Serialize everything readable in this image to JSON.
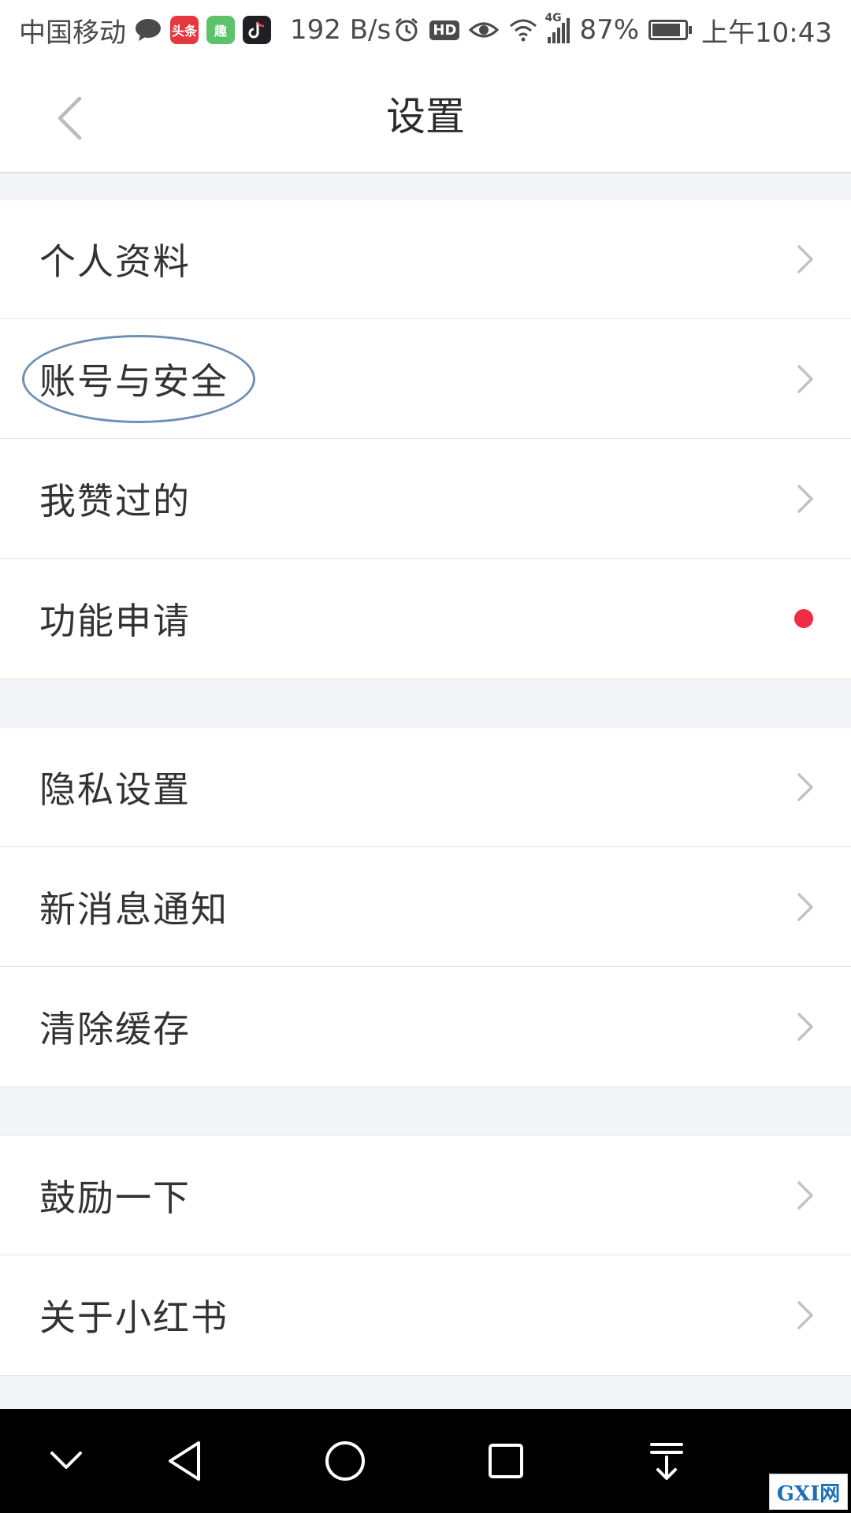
{
  "status_bar": {
    "carrier": "中国移动",
    "network_speed": "192 B/s",
    "hd_label": "HD",
    "network_type": "4G",
    "battery_percent": "87%",
    "battery_level": 0.87,
    "time": "上午10:43",
    "app_icons": [
      {
        "name": "toutiao-icon",
        "text": "头条",
        "color": "#e6393f"
      },
      {
        "name": "qutoutiao-icon",
        "text": "趣",
        "color": "#5cc36a"
      },
      {
        "name": "douyin-icon",
        "text": "",
        "color": "#1f1f24"
      }
    ]
  },
  "header": {
    "title": "设置"
  },
  "groups": [
    {
      "items": [
        {
          "label": "个人资料",
          "trailing": "chevron"
        },
        {
          "label": "账号与安全",
          "trailing": "chevron",
          "highlighted": true
        },
        {
          "label": "我赞过的",
          "trailing": "chevron"
        },
        {
          "label": "功能申请",
          "trailing": "red-dot"
        }
      ]
    },
    {
      "items": [
        {
          "label": "隐私设置",
          "trailing": "chevron"
        },
        {
          "label": "新消息通知",
          "trailing": "chevron"
        },
        {
          "label": "清除缓存",
          "trailing": "chevron"
        }
      ]
    },
    {
      "items": [
        {
          "label": "鼓励一下",
          "trailing": "chevron"
        },
        {
          "label": "关于小红书",
          "trailing": "chevron"
        }
      ]
    }
  ],
  "colors": {
    "red_dot": "#f02b44",
    "highlight_ring": "#6e8fb5",
    "section_gap": "#f3f5f8"
  },
  "watermark": {
    "text": "GXI网"
  }
}
